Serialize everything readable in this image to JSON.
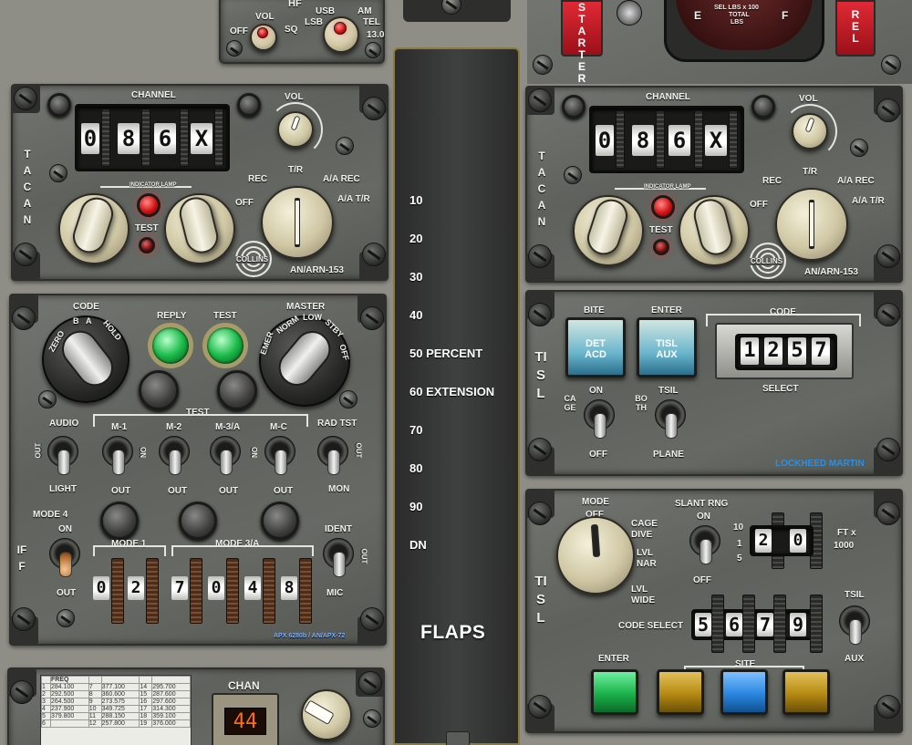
{
  "hf": {
    "title": "HF",
    "vol": "VOL",
    "off": "OFF",
    "sq": "SQ",
    "usb": "USB",
    "lsb": "LSB",
    "am": "AM",
    "tel": "TEL",
    "ver": "13.0"
  },
  "fuel": {
    "starter": "STARTER",
    "rel": "REL",
    "gauge_e": "E",
    "gauge_f": "F",
    "gauge_text_1": "SEL LBS x 100",
    "gauge_text_2": "TOTAL",
    "gauge_text_3": "LBS"
  },
  "tacan_left": {
    "side_label": "TACAN",
    "channel_label": "CHANNEL",
    "digits": [
      "0",
      "8",
      "6",
      "X"
    ],
    "vol_label": "VOL",
    "rec": "REC",
    "tr": "T/R",
    "aa_rec": "A/A REC",
    "off": "OFF",
    "aa_tr": "A/A T/R",
    "indicator": "INDICATOR LAMP",
    "test": "TEST",
    "brand": "COLLINS",
    "model": "AN/ARN-153"
  },
  "tacan_right": {
    "side_label": "TACAN",
    "channel_label": "CHANNEL",
    "digits": [
      "0",
      "8",
      "6",
      "X"
    ],
    "vol_label": "VOL",
    "rec": "REC",
    "tr": "T/R",
    "aa_rec": "A/A REC",
    "off": "OFF",
    "aa_tr": "A/A T/R",
    "indicator": "INDICATOR LAMP",
    "test": "TEST",
    "brand": "COLLINS",
    "model": "AN/ARN-153"
  },
  "iff": {
    "side_label": "IFF",
    "code": "CODE",
    "zero": "ZERO",
    "b": "B",
    "a": "A",
    "hold": "HOLD",
    "reply": "REPLY",
    "test": "TEST",
    "master": "MASTER",
    "emer": "EMER",
    "norm": "NORM",
    "low": "LOW",
    "stby": "STBY",
    "off": "OFF",
    "test_group": "TEST",
    "audio": "AUDIO",
    "m1": "M-1",
    "m2": "M-2",
    "m3a": "M-3/A",
    "mc": "M-C",
    "rad_tst": "RAD TST",
    "out": "OUT",
    "on": "ON",
    "light": "LIGHT",
    "mon": "MON",
    "mode4": "MODE 4",
    "mode1": "MODE 1",
    "mode3a": "MODE 3/A",
    "ident": "IDENT",
    "mic": "MIC",
    "mode1_digits": [
      "0",
      "2"
    ],
    "mode3a_digits": [
      "7",
      "0",
      "4",
      "8"
    ],
    "model": "APX 6280b / AN/APX-72"
  },
  "tisl1": {
    "side_label": "TISL",
    "bite": "BITE",
    "enter": "ENTER",
    "code": "CODE",
    "det_acd_1": "DET",
    "det_acd_2": "ACD",
    "tisl_aux_1": "TISL",
    "tisl_aux_2": "AUX",
    "digits": [
      "1",
      "2",
      "5",
      "7"
    ],
    "select": "SELECT",
    "cage": "CAGE",
    "on": "ON",
    "off": "OFF",
    "tsil": "TSIL",
    "both": "BOTH",
    "plane": "PLANE",
    "brand": "LOCKHEED MARTIN"
  },
  "tisl2": {
    "side_label": "TISL",
    "mode": "MODE",
    "off": "OFF",
    "cage_dive_1": "CAGE",
    "cage_dive_2": "DIVE",
    "lvl_nar_1": "LVL",
    "lvl_nar_2": "NAR",
    "lvl_wide_1": "LVL",
    "lvl_wide_2": "WIDE",
    "slant_rng": "SLANT RNG",
    "on": "ON",
    "off2": "OFF",
    "ranges": [
      "10",
      "1",
      "5"
    ],
    "range_digits": [
      "2",
      "0"
    ],
    "ft_x": "FT x",
    "ft_1000": "1000",
    "code_select": "CODE SELECT",
    "code_digits": [
      "5",
      "6",
      "7",
      "9"
    ],
    "tsil": "TSIL",
    "aux": "AUX",
    "enter": "ENTER",
    "site": "SITE"
  },
  "flaps": {
    "marks": [
      "10",
      "20",
      "30",
      "40",
      "50 PERCENT",
      "60 EXTENSION",
      "70",
      "80",
      "90",
      "DN"
    ],
    "title": "FLAPS"
  },
  "comm": {
    "freq_header": "FREQ",
    "rows": [
      [
        "1",
        "284.100",
        "7",
        "377.100",
        "14",
        "295.700"
      ],
      [
        "2",
        "292.500",
        "8",
        "360.600",
        "15",
        "287.600"
      ],
      [
        "3",
        "264.500",
        "9",
        "273.575",
        "16",
        "297.600"
      ],
      [
        "4",
        "237.900",
        "10",
        "349.725",
        "17",
        "314.300"
      ],
      [
        "5",
        "379.800",
        "11",
        "288.150",
        "18",
        "359.100"
      ],
      [
        "6",
        "",
        "12",
        "257.800",
        "19",
        "376.000"
      ]
    ],
    "chan_label": "CHAN",
    "chan_value": "44"
  },
  "colors": {
    "panel": "#676964",
    "amber": "#ff6a1a",
    "green": "#1fbf4b",
    "blue": "#2a86e0",
    "yellow": "#b98a12",
    "red": "#c41e2a"
  }
}
